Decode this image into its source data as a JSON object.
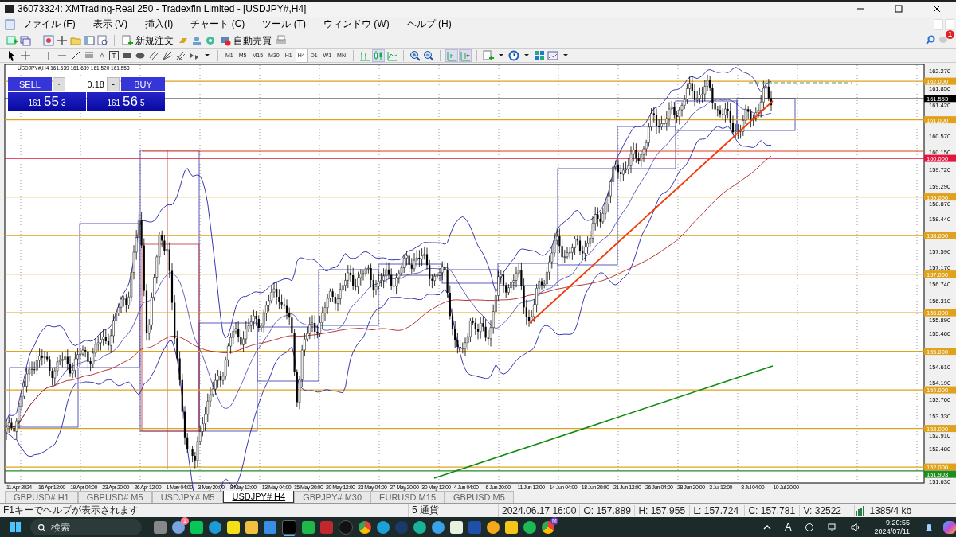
{
  "window": {
    "title": "36073324: XMTrading-Real 250 - Tradexfin Limited - [USDJPY#,H4]"
  },
  "menu": [
    "ファイル (F)",
    "表示 (V)",
    "挿入(I)",
    "チャート (C)",
    "ツール (T)",
    "ウィンドウ (W)",
    "ヘルプ (H)"
  ],
  "toolbar": {
    "new_order": "新規注文",
    "auto_trading": "自動売買",
    "notification_badge": "1"
  },
  "drawing_tools": {
    "text_tool": "A",
    "text_label_tool": "T"
  },
  "timeframes": [
    {
      "label": "M1",
      "selected": false
    },
    {
      "label": "M5",
      "selected": false
    },
    {
      "label": "M15",
      "selected": false
    },
    {
      "label": "M30",
      "selected": false
    },
    {
      "label": "H1",
      "selected": false
    },
    {
      "label": "H4",
      "selected": true
    },
    {
      "label": "D1",
      "selected": false
    },
    {
      "label": "W1",
      "selected": false
    },
    {
      "label": "MN",
      "selected": false
    }
  ],
  "chart": {
    "header": "USDJPY#,H4  161.639 161.639 161.520 161.553",
    "one_click": {
      "sell": "SELL",
      "buy": "BUY",
      "lots": "0.18",
      "bid": {
        "big": "161",
        "main": "55",
        "sup": "3"
      },
      "ask": {
        "big": "161",
        "main": "56",
        "sup": "5"
      }
    },
    "price_labels": [
      "162.270",
      "161.850",
      "161.420",
      "160.570",
      "160.150",
      "159.720",
      "159.290",
      "158.870",
      "158.440",
      "157.590",
      "157.170",
      "156.740",
      "156.310",
      "155.890",
      "155.460",
      "154.610",
      "154.190",
      "153.760",
      "153.330",
      "152.910",
      "152.480",
      "151.630"
    ],
    "levels": [
      {
        "label": "162.000",
        "color": "#e0a21c"
      },
      {
        "label": "161.553",
        "color": "#000000"
      },
      {
        "label": "161.000",
        "color": "#e0a21c"
      },
      {
        "label": "160.000",
        "color": "#e3163c"
      },
      {
        "label": "159.000",
        "color": "#e0a21c"
      },
      {
        "label": "158.000",
        "color": "#e0a21c"
      },
      {
        "label": "157.000",
        "color": "#e0a21c"
      },
      {
        "label": "156.000",
        "color": "#e0a21c"
      },
      {
        "label": "155.000",
        "color": "#e0a21c"
      },
      {
        "label": "154.000",
        "color": "#e0a21c"
      },
      {
        "label": "153.000",
        "color": "#e0a21c"
      },
      {
        "label": "152.000",
        "color": "#e0a21c"
      },
      {
        "label": "151.903",
        "color": "#1e8c1e"
      }
    ],
    "time_labels": [
      "11 Apr 2024",
      "16 Apr 12:00",
      "19 Apr 04:00",
      "23 Apr 20:00",
      "26 Apr 12:00",
      "1 May 04:00",
      "3 May 20:00",
      "8 May 12:00",
      "13 May 04:00",
      "15 May 20:00",
      "20 May 12:00",
      "23 May 04:00",
      "27 May 20:00",
      "30 May 12:00",
      "4 Jun 04:00",
      "6 Jun 20:00",
      "11 Jun 12:00",
      "14 Jun 04:00",
      "18 Jun 20:00",
      "21 Jun 12:00",
      "26 Jun 04:00",
      "28 Jun 20:00",
      "3 Jul 12:00",
      "8 Jul 04:00",
      "10 Jul 20:00"
    ]
  },
  "tabs": [
    {
      "label": "GBPUSD# H1",
      "selected": false
    },
    {
      "label": "GBPUSD# M5",
      "selected": false
    },
    {
      "label": "USDJPY# M5",
      "selected": false
    },
    {
      "label": "USDJPY# H4",
      "selected": true
    },
    {
      "label": "GBPJPY# M30",
      "selected": false
    },
    {
      "label": "EURUSD M15",
      "selected": false
    },
    {
      "label": "GBPUSD M5",
      "selected": false
    }
  ],
  "status_bar": {
    "help": "F1キーでヘルプが表示されます",
    "symbols": "5 通貨",
    "time": "2024.06.17 16:00",
    "open": "O: 157.889",
    "high": "H: 157.955",
    "low": "L: 157.724",
    "close": "C: 157.781",
    "volume": "V: 32522",
    "traffic": "1385/4 kb"
  },
  "taskbar": {
    "search_placeholder": "検索",
    "cloud_badge": "1",
    "profile_badge": "M",
    "ime": "A",
    "time": "9:20:55",
    "date": "2024/07/11"
  }
}
